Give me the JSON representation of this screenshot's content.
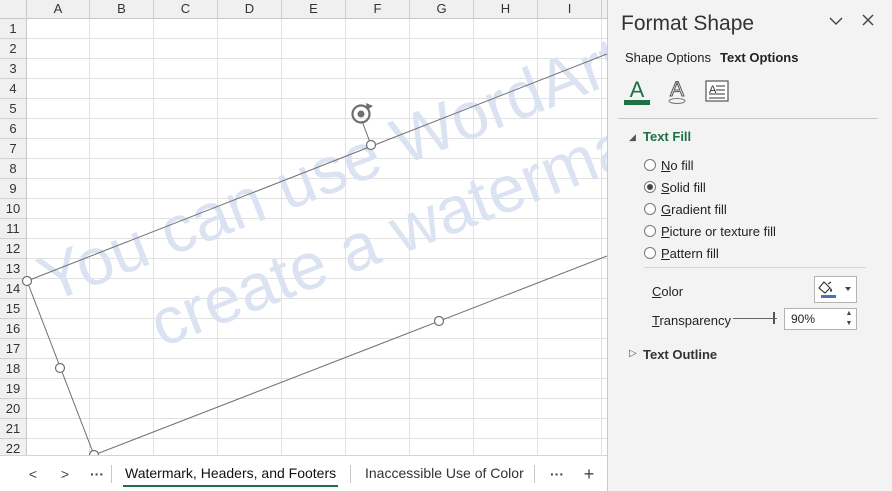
{
  "sheet": {
    "columns": [
      "A",
      "B",
      "C",
      "D",
      "E",
      "F",
      "G",
      "H",
      "I"
    ],
    "rows": [
      "1",
      "2",
      "3",
      "4",
      "5",
      "6",
      "7",
      "8",
      "9",
      "10",
      "11",
      "12",
      "13",
      "14",
      "15",
      "16",
      "17",
      "18",
      "19",
      "20",
      "21",
      "22"
    ],
    "watermark": {
      "line1": "You can use WordArt to",
      "line2": "create a watermark",
      "color": "#dbe3f2"
    }
  },
  "tabs": {
    "prev": "<",
    "next": ">",
    "more_left": "···",
    "sheets": [
      "Watermark, Headers, and Footers",
      "Inaccessible Use of Color"
    ],
    "active_index": 0,
    "more_right": "···",
    "add": "+",
    "accent": "#1e7145"
  },
  "pane": {
    "title": "Format Shape",
    "option_tabs": [
      "Shape Options",
      "Text Options"
    ],
    "icons": [
      "text-fill-outline-icon",
      "text-effects-icon",
      "textbox-icon"
    ],
    "text_fill": {
      "header": "Text Fill",
      "color": "#1e7145",
      "options": [
        {
          "key": "N",
          "rest": "o fill",
          "checked": false
        },
        {
          "key": "S",
          "rest": "olid fill",
          "checked": true
        },
        {
          "key": "G",
          "rest": "radient fill",
          "checked": false
        },
        {
          "key": "P",
          "rest": "icture or texture fill",
          "checked": false
        },
        {
          "key": "A",
          "rest": "Pattern fill",
          "checked": false
        }
      ],
      "color_label_key": "C",
      "color_label_rest": "olor",
      "transparency_label_key": "T",
      "transparency_label_rest": "ransparency",
      "transparency_value": "90%",
      "transparency_fraction": 0.9
    },
    "text_outline": {
      "header": "Text Outline"
    }
  }
}
